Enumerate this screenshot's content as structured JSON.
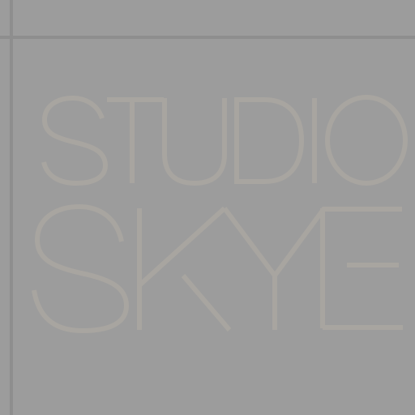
{
  "logo": {
    "line1": "STUDIO",
    "line2": "SKYE",
    "stroke_color": "#a8a5a0"
  },
  "colors": {
    "background": "#9c9c9c",
    "guide_lines": "#8e8e8e"
  }
}
